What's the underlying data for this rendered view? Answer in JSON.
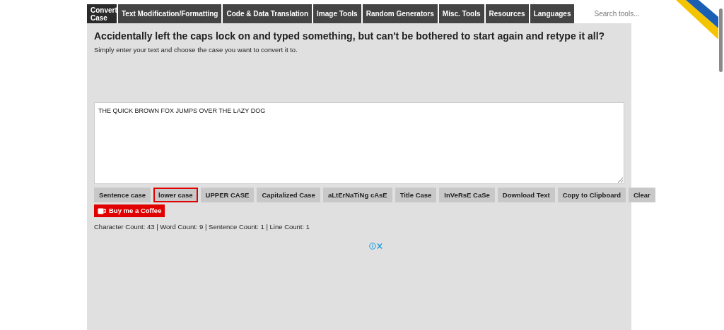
{
  "nav": {
    "tabs": [
      {
        "label": "Convert Case",
        "selected": true
      },
      {
        "label": "Text Modification/Formatting",
        "selected": false
      },
      {
        "label": "Code & Data Translation",
        "selected": false
      },
      {
        "label": "Image Tools",
        "selected": false
      },
      {
        "label": "Random Generators",
        "selected": false
      },
      {
        "label": "Misc. Tools",
        "selected": false
      },
      {
        "label": "Resources",
        "selected": false
      },
      {
        "label": "Languages",
        "selected": false
      }
    ],
    "search": {
      "placeholder": "Search tools..."
    }
  },
  "heading": "Accidentally left the caps lock on and typed something, but can't be bothered to start again and retype it all?",
  "subtitle": "Simply enter your text and choose the case you want to convert it to.",
  "editor": {
    "value": "THE QUICK BROWN FOX JUMPS OVER THE LAZY DOG"
  },
  "case_buttons": [
    {
      "label": "Sentence case",
      "selected": false
    },
    {
      "label": "lower case",
      "selected": true
    },
    {
      "label": "UPPER CASE",
      "selected": false
    },
    {
      "label": "Capitalized Case",
      "selected": false
    },
    {
      "label": "aLtErNaTiNg cAsE",
      "selected": false
    },
    {
      "label": "Title Case",
      "selected": false
    },
    {
      "label": "InVeRsE CaSe",
      "selected": false
    },
    {
      "label": "Download Text",
      "selected": false
    },
    {
      "label": "Copy to Clipboard",
      "selected": false
    },
    {
      "label": "Clear",
      "selected": false
    }
  ],
  "coffee_button": {
    "label": "Buy me a Coffee"
  },
  "counts": "Character Count: 43 | Word Count: 9 | Sentence Count: 1 | Line Count: 1"
}
